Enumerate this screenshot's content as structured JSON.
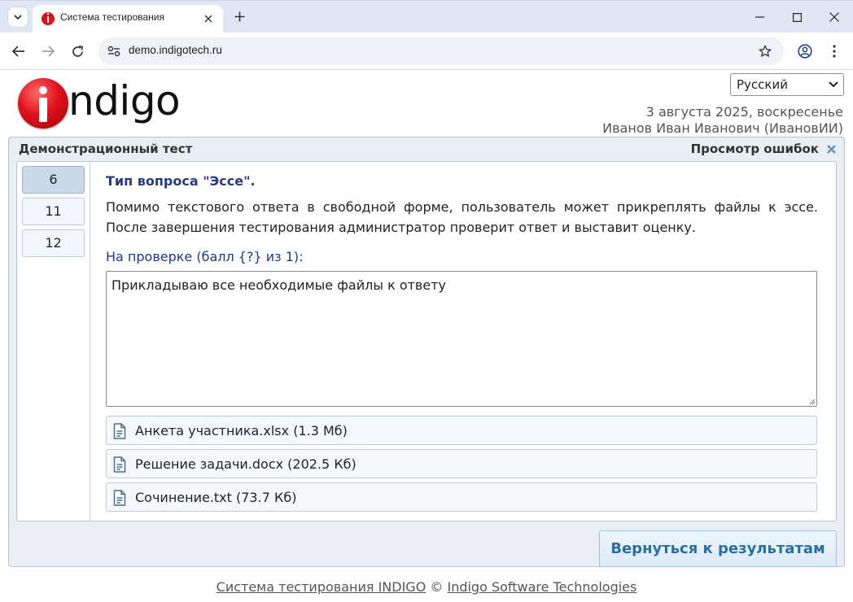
{
  "browser": {
    "tab_title": "Система тестирования",
    "url": "demo.indigotech.ru",
    "icons": {
      "tab_menu": "chevron-down-icon",
      "favicon": "indigo-favicon-icon",
      "tab_close": "close-icon",
      "new_tab": "plus-icon",
      "minimize": "minimize-icon",
      "maximize": "maximize-icon",
      "close": "close-icon",
      "back": "arrow-left-icon",
      "forward": "arrow-right-icon",
      "reload": "reload-icon",
      "site_info": "tune-icon",
      "bookmark": "star-icon",
      "profile": "account-icon",
      "menu": "more-vertical-icon"
    }
  },
  "header": {
    "logo_text": "ndigo",
    "language": "Русский",
    "date": "3 августа 2025, воскресенье",
    "user": "Иванов Иван Иванович (ИвановИИ)"
  },
  "panel": {
    "title": "Демонстрационный тест",
    "mode": "Просмотр ошибок"
  },
  "question_nav": [
    {
      "label": "6",
      "active": true
    },
    {
      "label": "11",
      "active": false
    },
    {
      "label": "12",
      "active": false
    }
  ],
  "question": {
    "type": "Тип вопроса \"Эссе\".",
    "text": "Помимо текстового ответа в свободной форме, пользователь может прикреплять файлы к эссе. После завершения тестирования администратор проверит ответ и выставит оценку.",
    "status": "На проверке (балл {?} из 1):",
    "answer": "Прикладываю все необходимые файлы к ответу",
    "files": [
      {
        "label": "Анкета участника.xlsx (1.3 Мб)"
      },
      {
        "label": "Решение задачи.docx (202.5 Кб)"
      },
      {
        "label": "Сочинение.txt (73.7 Кб)"
      }
    ]
  },
  "actions": {
    "back_label": "Вернуться к результатам"
  },
  "footer": {
    "system_link": "Система тестирования INDIGO",
    "copyright": "©",
    "company_link": "Indigo Software Technologies"
  },
  "colors": {
    "accent": "#2a3b86",
    "logo_red": "#e0121c",
    "panel_bg": "#e9eef4",
    "button_text": "#2e6e9e"
  }
}
